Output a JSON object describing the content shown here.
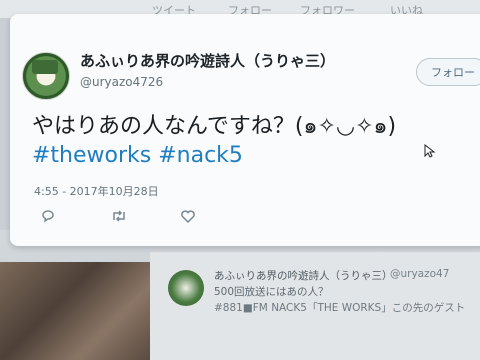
{
  "nav": {
    "tweets": "ツイート",
    "following": "フォロー",
    "followers": "フォロワー",
    "likes": "いいね"
  },
  "tweet": {
    "display_name": "あふぃりあ界の吟遊詩人（うりゃ三）",
    "handle": "@uryazo4726",
    "follow_label": "フォロー",
    "text": "やはりあの人なんですね？(๑✧◡✧๑)",
    "hashtags": "#theworks #nack5",
    "timestamp": "4:55 - 2017年10月28日"
  },
  "background_tweet": {
    "display_name": "あふぃりあ界の吟遊詩人（うりゃ三）",
    "handle": "@uryazo47",
    "line1": "500回放送にはあの人？",
    "line2": "#881■FM NACK5「THE WORKS」この先のゲスト"
  },
  "colors": {
    "hashtag": "#1f7ec2",
    "card_bg": "#fafbfc",
    "text": "#1a1f23"
  }
}
